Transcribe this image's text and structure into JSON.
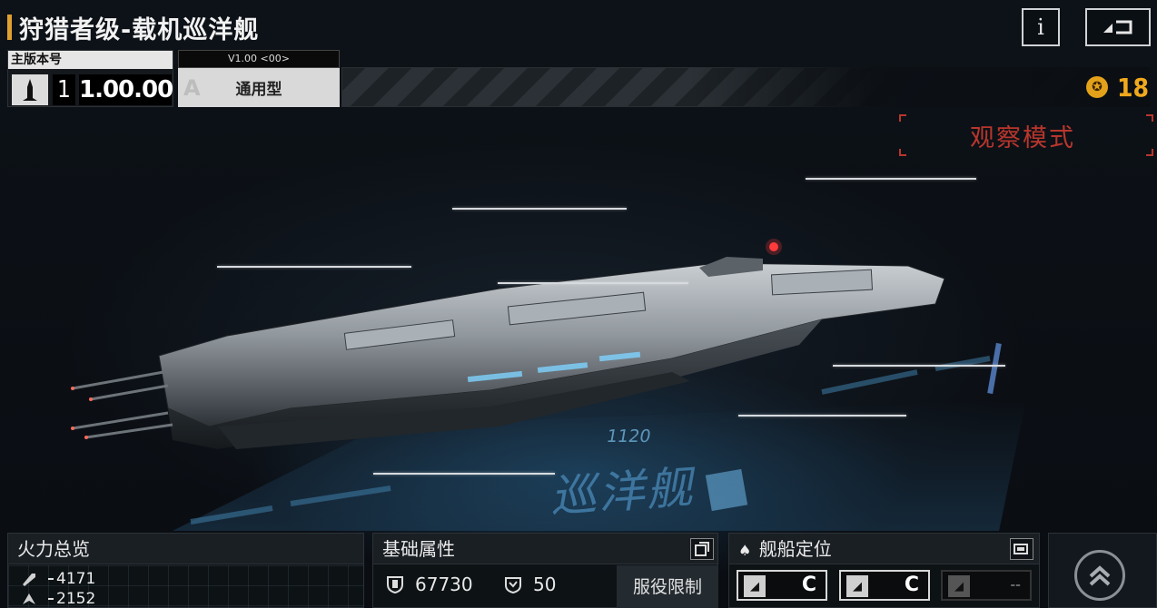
{
  "header": {
    "title": "狩猎者级-载机巡洋舰",
    "info_button": "i"
  },
  "version": {
    "main_label": "主版本号",
    "main_number": "1",
    "main_version": "1.00.00",
    "sub_label": "V1.00 <00>",
    "sub_letter": "A",
    "sub_type": "通用型"
  },
  "resource": {
    "count": "18",
    "color": "#f0a81c"
  },
  "view_mode": {
    "label": "观察模式",
    "color": "#b8362c"
  },
  "hologram": {
    "number": "1120",
    "class_text": "巡洋舰"
  },
  "firepower": {
    "title": "火力总览",
    "rows": [
      {
        "icon": "anti-ship-icon",
        "value": "4171"
      },
      {
        "icon": "anti-air-icon",
        "value": "2152"
      }
    ]
  },
  "base_attributes": {
    "title": "基础属性",
    "hp": "67730",
    "armor": "50",
    "service_limit": "服役限制"
  },
  "ship_role": {
    "title": "舰船定位",
    "slots": [
      {
        "grade": "C",
        "active": true
      },
      {
        "grade": "C",
        "active": true
      },
      {
        "grade": "--",
        "active": false
      }
    ]
  }
}
